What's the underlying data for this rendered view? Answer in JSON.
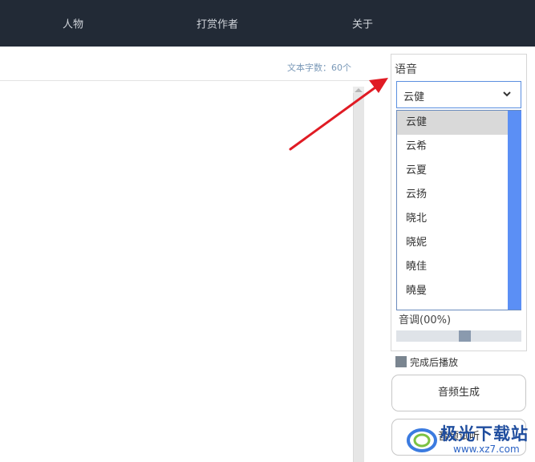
{
  "nav": {
    "items": [
      "人物",
      "打赏作者",
      "关于"
    ]
  },
  "editor": {
    "char_count": "文本字数：60个"
  },
  "panel": {
    "voice_label": "语音",
    "selected_voice": "云健",
    "voice_options": [
      "云健",
      "云希",
      "云夏",
      "云扬",
      "晓北",
      "晓妮",
      "曉佳",
      "曉曼"
    ],
    "pitch_label": "音调(00%)",
    "pitch_value_fraction": 0.55,
    "play_after_label": "完成后播放",
    "generate_button": "音频生成",
    "listen_button": "音频试听"
  },
  "watermark": {
    "brand": "极光下载站",
    "url": "www.xz7.com"
  },
  "colors": {
    "nav_bg": "#222a36",
    "accent_blue": "#5b8ff5",
    "arrow_red": "#e01b24"
  },
  "icons": {
    "select_chevron": "chevron-down-icon",
    "watermark_logo": "swirl-logo-icon"
  }
}
